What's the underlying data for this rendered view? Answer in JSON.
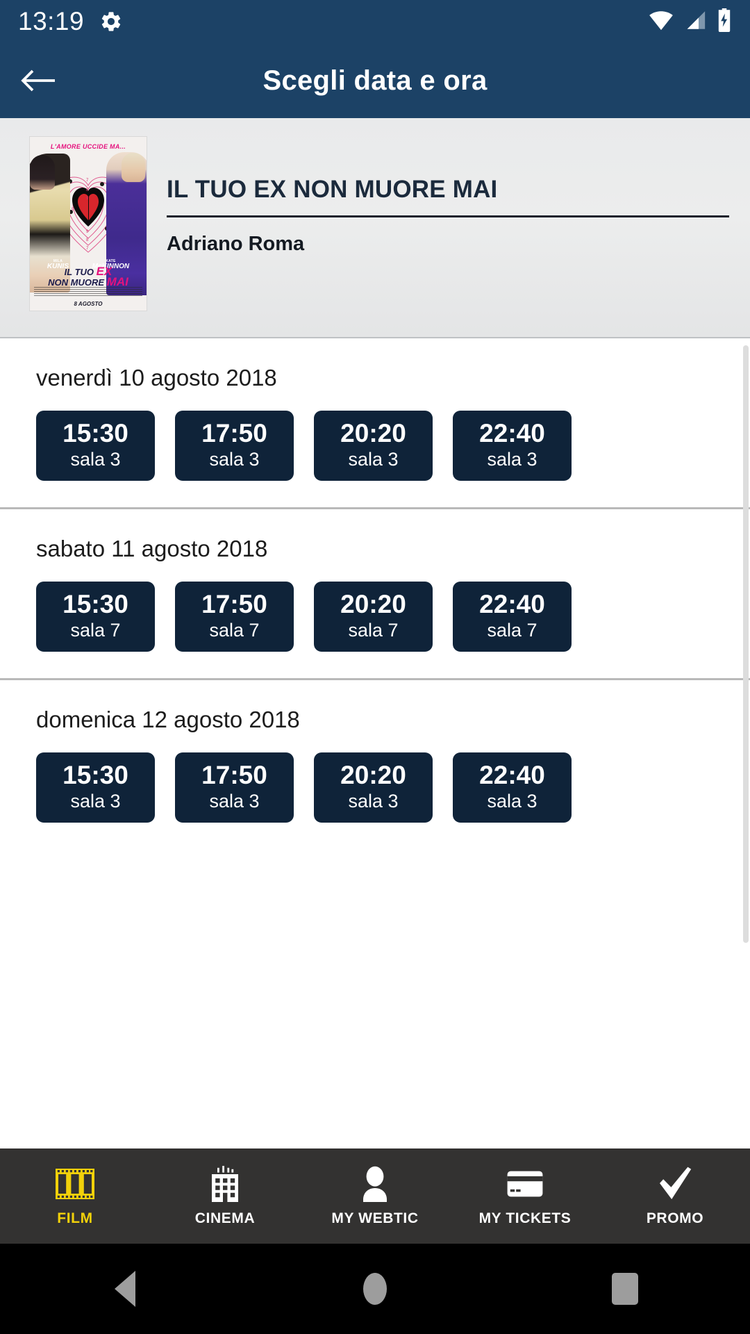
{
  "status_bar": {
    "time": "13:19",
    "icons": [
      "gear-icon",
      "wifi-icon",
      "cellular-signal-icon",
      "battery-charging-icon"
    ]
  },
  "app_bar": {
    "back_icon": "arrow-left-icon",
    "title": "Scegli data e ora"
  },
  "movie": {
    "title": "IL TUO EX NON MUORE MAI",
    "cinema": "Adriano Roma",
    "poster": {
      "tagline": "L'AMORE UCCIDE MA...",
      "actor_1_first": "MILA",
      "actor_1_last": "KUNIS",
      "actor_2_first": "KATE",
      "actor_2_last": "McKINNON",
      "title_line_1_a": "IL TUO ",
      "title_line_1_b": "EX",
      "title_line_2_a": "NON MUORE ",
      "title_line_2_b": "MAI",
      "release_date": "8 AGOSTO"
    }
  },
  "showtimes": {
    "groups": [
      {
        "date": "venerdì 10 agosto 2018",
        "screenings": [
          {
            "time": "15:30",
            "hall": "sala 3"
          },
          {
            "time": "17:50",
            "hall": "sala 3"
          },
          {
            "time": "20:20",
            "hall": "sala 3"
          },
          {
            "time": "22:40",
            "hall": "sala 3"
          }
        ]
      },
      {
        "date": "sabato 11 agosto 2018",
        "screenings": [
          {
            "time": "15:30",
            "hall": "sala 7"
          },
          {
            "time": "17:50",
            "hall": "sala 7"
          },
          {
            "time": "20:20",
            "hall": "sala 7"
          },
          {
            "time": "22:40",
            "hall": "sala 7"
          }
        ]
      },
      {
        "date": "domenica 12 agosto 2018",
        "screenings": [
          {
            "time": "15:30",
            "hall": "sala 3"
          },
          {
            "time": "17:50",
            "hall": "sala 3"
          },
          {
            "time": "20:20",
            "hall": "sala 3"
          },
          {
            "time": "22:40",
            "hall": "sala 3"
          }
        ]
      }
    ]
  },
  "tab_bar": {
    "items": [
      {
        "label": "FILM",
        "icon": "film-strip-icon",
        "active": true
      },
      {
        "label": "CINEMA",
        "icon": "building-icon",
        "active": false
      },
      {
        "label": "MY WEBTIC",
        "icon": "person-icon",
        "active": false
      },
      {
        "label": "MY TICKETS",
        "icon": "credit-card-icon",
        "active": false
      },
      {
        "label": "PROMO",
        "icon": "checkmark-icon",
        "active": false
      }
    ]
  },
  "android_nav": {
    "back": "triangle-back-icon",
    "home": "circle-home-icon",
    "recents": "square-recents-icon"
  },
  "colors": {
    "app_bar": "#1c4266",
    "showtime_card": "#0f2339",
    "tab_bar": "#333231",
    "tab_active": "#f2d10a"
  }
}
